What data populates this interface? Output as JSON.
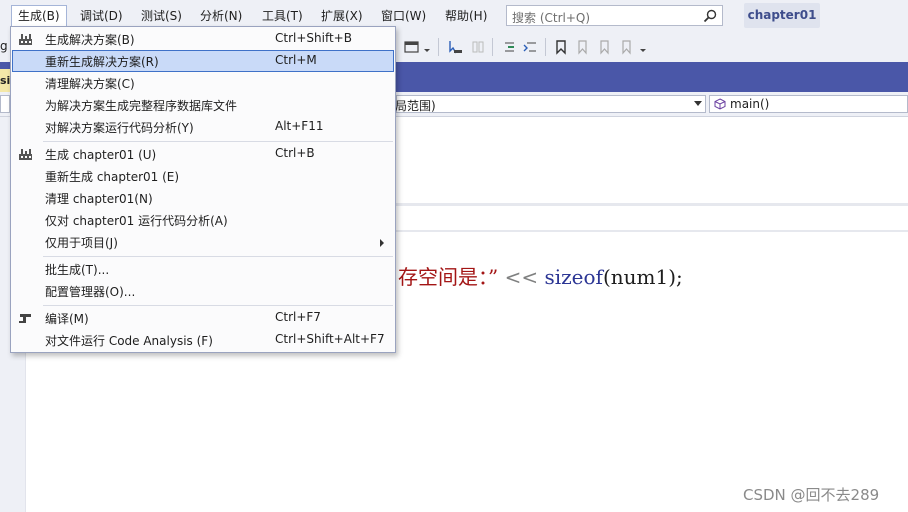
{
  "menubar": {
    "items": [
      "生成(B)",
      "调试(D)",
      "测试(S)",
      "分析(N)",
      "工具(T)",
      "扩展(X)",
      "窗口(W)",
      "帮助(H)"
    ],
    "search_placeholder": "搜索 (Ctrl+Q)",
    "project_name": "chapter01"
  },
  "tab": {
    "stub_text": "si"
  },
  "navbar": {
    "scope_text": "局范围)",
    "member_text": "main()"
  },
  "editor": {
    "code": {
      "str": "存空间是：”",
      "op": " << ",
      "fn": "sizeof",
      "rest": "(num1);"
    }
  },
  "build_menu": {
    "items": [
      {
        "label": "生成解决方案(B)",
        "shortcut": "Ctrl+Shift+B",
        "icon": "build-icon"
      },
      {
        "label": "重新生成解决方案(R)",
        "shortcut": "Ctrl+M",
        "highlighted": true
      },
      {
        "label": "清理解决方案(C)",
        "shortcut": ""
      },
      {
        "label": "为解决方案生成完整程序数据库文件",
        "shortcut": ""
      },
      {
        "label": "对解决方案运行代码分析(Y)",
        "shortcut": "Alt+F11"
      },
      {
        "label": "生成 chapter01 (U)",
        "shortcut": "Ctrl+B",
        "icon": "build-icon"
      },
      {
        "label": "重新生成 chapter01 (E)",
        "shortcut": ""
      },
      {
        "label": "清理 chapter01(N)",
        "shortcut": ""
      },
      {
        "label": "仅对 chapter01 运行代码分析(A)",
        "shortcut": ""
      },
      {
        "label": "仅用于项目(J)",
        "shortcut": "",
        "submenu": true
      },
      {
        "label": "批生成(T)...",
        "shortcut": ""
      },
      {
        "label": "配置管理器(O)...",
        "shortcut": ""
      },
      {
        "label": "编译(M)",
        "shortcut": "Ctrl+F7",
        "icon": "compile-icon"
      },
      {
        "label": "对文件运行 Code Analysis (F)",
        "shortcut": "Ctrl+Shift+Alt+F7"
      }
    ]
  },
  "watermark": "CSDN @回不去289",
  "colors": {
    "menubar_bg": "#eef0f6",
    "tab_strip": "#4a57a8",
    "menu_highlight": "#c9daf8",
    "string_literal": "#a31515",
    "function_name": "#2b3594"
  }
}
